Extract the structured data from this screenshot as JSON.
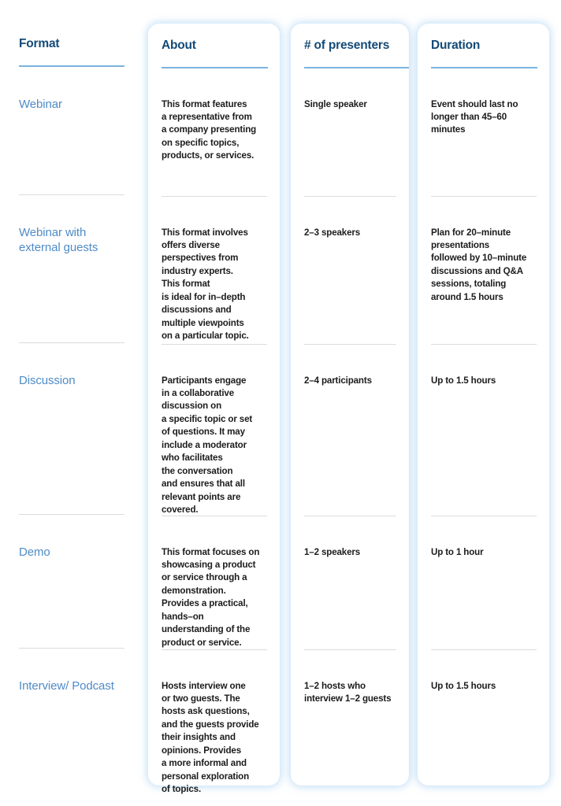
{
  "table": {
    "columns": [
      {
        "id": "format",
        "header": "Format"
      },
      {
        "id": "about",
        "header": "About"
      },
      {
        "id": "presenters",
        "header": "# of presenters"
      },
      {
        "id": "duration",
        "header": "Duration"
      }
    ],
    "rows": [
      {
        "format": "Webinar",
        "about": "This format features\na representative from\na company presenting\non specific topics,\nproducts, or services.",
        "presenters": "Single speaker",
        "duration": "Event should last no\nlonger than 45–60\nminutes"
      },
      {
        "format": "Webinar with\nexternal guests",
        "about": "This format involves\noffers diverse\nperspectives from\nindustry experts.\nThis format\nis ideal for in–depth\ndiscussions and\nmultiple viewpoints\non a particular topic.",
        "presenters": "2–3 speakers",
        "duration": "Plan for 20–minute\npresentations\nfollowed by 10–minute\ndiscussions and Q&A\nsessions, totaling\naround 1.5 hours"
      },
      {
        "format": "Discussion",
        "about": "Participants engage\nin a collaborative\ndiscussion on\na specific topic or set\nof questions. It may\ninclude a moderator\nwho facilitates\nthe conversation\nand ensures that all\nrelevant points are\ncovered.",
        "presenters": "2–4 participants",
        "duration": "Up to 1.5 hours"
      },
      {
        "format": "Demo",
        "about": "This format focuses on\nshowcasing a product\nor service through a\ndemonstration.\nProvides a practical,\nhands–on\nunderstanding of the\nproduct or service.",
        "presenters": "1–2 speakers",
        "duration": "Up to 1 hour"
      },
      {
        "format": "Interview/\nPodcast",
        "about": "Hosts interview one\nor two guests. The\nhosts ask questions,\nand the guests provide\ntheir insights and\nopinions. Provides\na more informal and\npersonal exploration\nof topics.",
        "presenters": "1–2 hosts who\ninterview 1–2 guests",
        "duration": "Up to 1.5 hours"
      }
    ]
  },
  "colors": {
    "header_text": "#134a77",
    "header_rule": "#7ab3e0",
    "row_label": "#4f8bc7",
    "body_text": "#1c1c1c",
    "divider": "#dcdcdc",
    "card_glow": "#96c6ee",
    "background": "#ffffff"
  }
}
